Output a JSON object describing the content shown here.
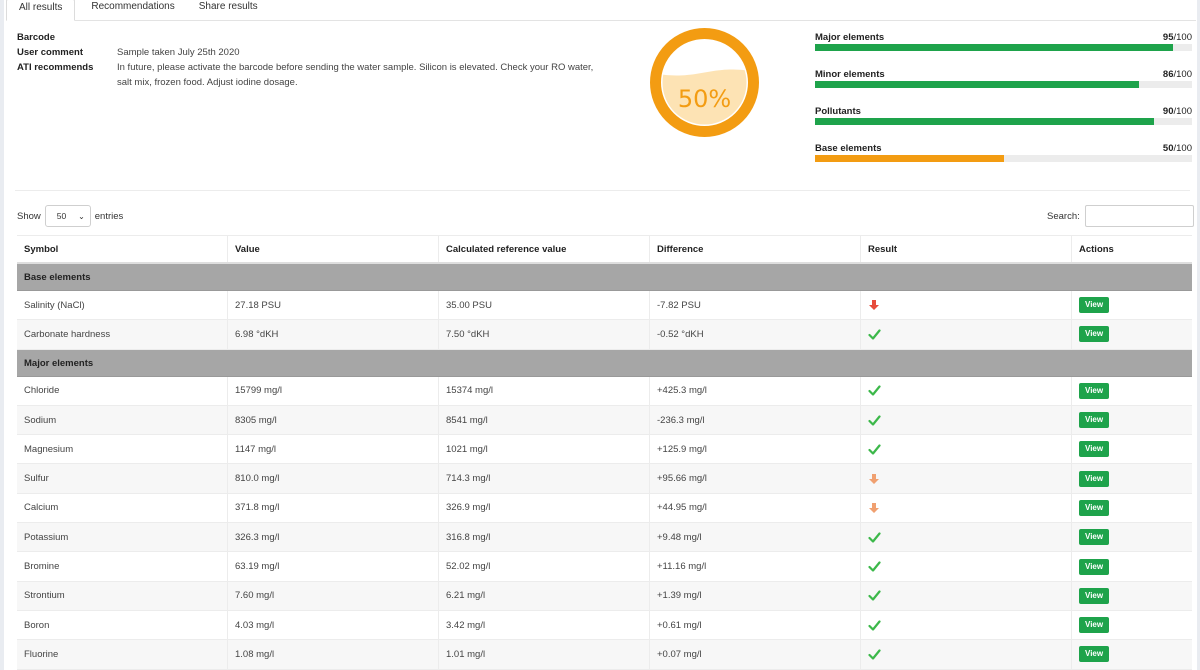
{
  "tabs": [
    "All results",
    "Recommendations",
    "Share results"
  ],
  "info": {
    "barcode_label": "Barcode",
    "comment_label": "User comment",
    "comment_value": "Sample taken July 25th 2020",
    "recommend_label": "ATI recommends",
    "recommend_value": "In future, please activate the barcode before sending the water sample. Silicon is elevated. Check your RO water, salt mix, frozen food. Adjust iodine dosage."
  },
  "gauge": {
    "text": "50%",
    "level": 0.5,
    "color": "#f39c12",
    "fill_color": "#fde3b4"
  },
  "scores": [
    {
      "label": "Major elements",
      "value": "95",
      "max": "/100",
      "fraction": 0.95,
      "color": "#1ea34b"
    },
    {
      "label": "Minor elements",
      "value": "86",
      "max": "/100",
      "fraction": 0.86,
      "color": "#1ea34b"
    },
    {
      "label": "Pollutants",
      "value": "90",
      "max": "/100",
      "fraction": 0.9,
      "color": "#1ea34b"
    },
    {
      "label": "Base elements",
      "value": "50",
      "max": "/100",
      "fraction": 0.5,
      "color": "#f39c12"
    }
  ],
  "controls": {
    "show_label": "Show",
    "entries_value": "50",
    "entries_label": "entries",
    "search_label": "Search:"
  },
  "table": {
    "headers": [
      "Symbol",
      "Value",
      "Calculated reference value",
      "Difference",
      "Result",
      "Actions"
    ],
    "view_label": "View",
    "groups": [
      {
        "name": "Base elements",
        "rows": [
          {
            "symbol": "Salinity (NaCl)",
            "value": "27.18 PSU",
            "reference": "35.00 PSU",
            "difference": "-7.82 PSU",
            "result": "arrow-down-red-icon"
          },
          {
            "symbol": "Carbonate hardness",
            "value": "6.98 °dKH",
            "reference": "7.50 °dKH",
            "difference": "-0.52 °dKH",
            "result": "check-icon"
          }
        ]
      },
      {
        "name": "Major elements",
        "rows": [
          {
            "symbol": "Chloride",
            "value": "15799 mg/l",
            "reference": "15374 mg/l",
            "difference": "+425.3 mg/l",
            "result": "check-icon"
          },
          {
            "symbol": "Sodium",
            "value": "8305 mg/l",
            "reference": "8541 mg/l",
            "difference": "-236.3 mg/l",
            "result": "check-icon"
          },
          {
            "symbol": "Magnesium",
            "value": "1147 mg/l",
            "reference": "1021 mg/l",
            "difference": "+125.9 mg/l",
            "result": "check-icon"
          },
          {
            "symbol": "Sulfur",
            "value": "810.0 mg/l",
            "reference": "714.3 mg/l",
            "difference": "+95.66 mg/l",
            "result": "arrow-up-orange-icon"
          },
          {
            "symbol": "Calcium",
            "value": "371.8 mg/l",
            "reference": "326.9 mg/l",
            "difference": "+44.95 mg/l",
            "result": "arrow-up-orange-icon"
          },
          {
            "symbol": "Potassium",
            "value": "326.3 mg/l",
            "reference": "316.8 mg/l",
            "difference": "+9.48 mg/l",
            "result": "check-icon"
          },
          {
            "symbol": "Bromine",
            "value": "63.19 mg/l",
            "reference": "52.02 mg/l",
            "difference": "+11.16 mg/l",
            "result": "check-icon"
          },
          {
            "symbol": "Strontium",
            "value": "7.60 mg/l",
            "reference": "6.21 mg/l",
            "difference": "+1.39 mg/l",
            "result": "check-icon"
          },
          {
            "symbol": "Boron",
            "value": "4.03 mg/l",
            "reference": "3.42 mg/l",
            "difference": "+0.61 mg/l",
            "result": "check-icon"
          },
          {
            "symbol": "Fluorine",
            "value": "1.08 mg/l",
            "reference": "1.01 mg/l",
            "difference": "+0.07 mg/l",
            "result": "check-icon"
          }
        ]
      }
    ]
  }
}
